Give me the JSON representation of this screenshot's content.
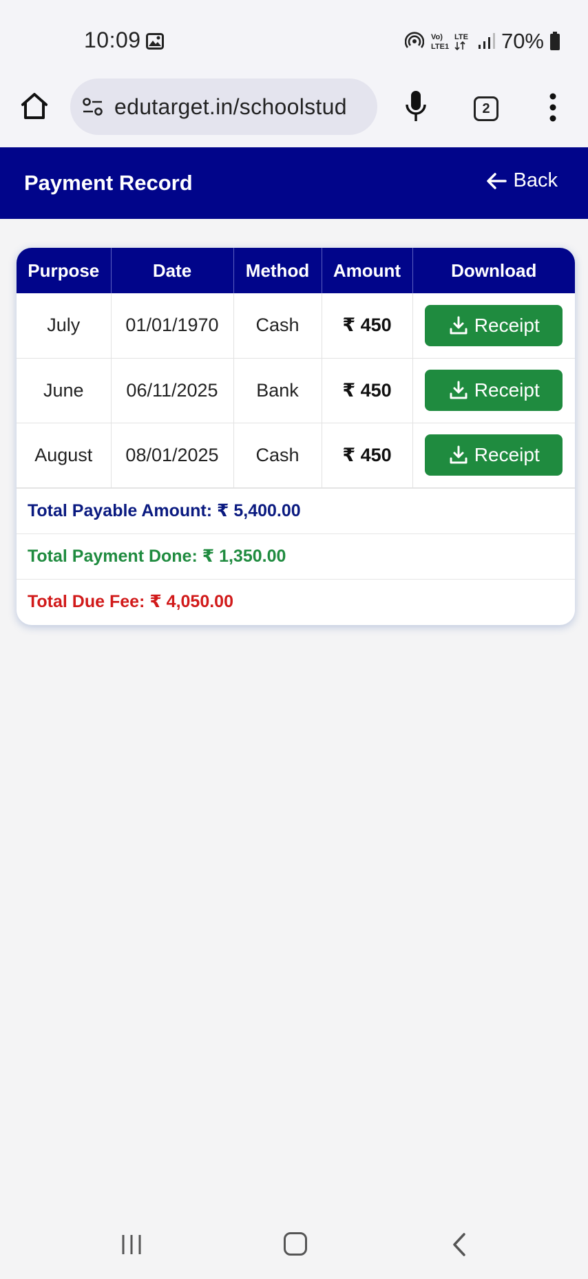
{
  "status_bar": {
    "time": "10:09",
    "battery": "70%",
    "network_labels": [
      "Vo) LTE1",
      "LTE"
    ]
  },
  "browser": {
    "url": "edutarget.in/schoolstud",
    "tab_count": "2"
  },
  "header": {
    "title": "Payment Record",
    "back_label": "Back"
  },
  "table": {
    "columns": [
      "Purpose",
      "Date",
      "Method",
      "Amount",
      "Download"
    ],
    "rows": [
      {
        "purpose": "July",
        "date": "01/01/1970",
        "method": "Cash",
        "amount": "₹ 450",
        "download": "Receipt"
      },
      {
        "purpose": "June",
        "date": "06/11/2025",
        "method": "Bank",
        "amount": "₹ 450",
        "download": "Receipt"
      },
      {
        "purpose": "August",
        "date": "08/01/2025",
        "method": "Cash",
        "amount": "₹ 450",
        "download": "Receipt"
      }
    ]
  },
  "summary": {
    "payable": "Total Payable Amount: ₹ 5,400.00",
    "paid": "Total Payment Done: ₹ 1,350.00",
    "due": "Total Due Fee: ₹ 4,050.00"
  },
  "colors": {
    "header": "#01058a",
    "button": "#1f8b3f",
    "payable": "#0a1a80",
    "paid": "#1f8b3f",
    "due": "#d11a1a"
  },
  "icons": [
    "photo-icon",
    "hotspot-icon",
    "signal-icon",
    "battery-icon",
    "home-icon",
    "site-settings-icon",
    "mic-icon",
    "tabs-icon",
    "menu-icon",
    "back-arrow-icon",
    "download-icon",
    "nav-recent-icon",
    "nav-home-icon",
    "nav-back-icon"
  ]
}
